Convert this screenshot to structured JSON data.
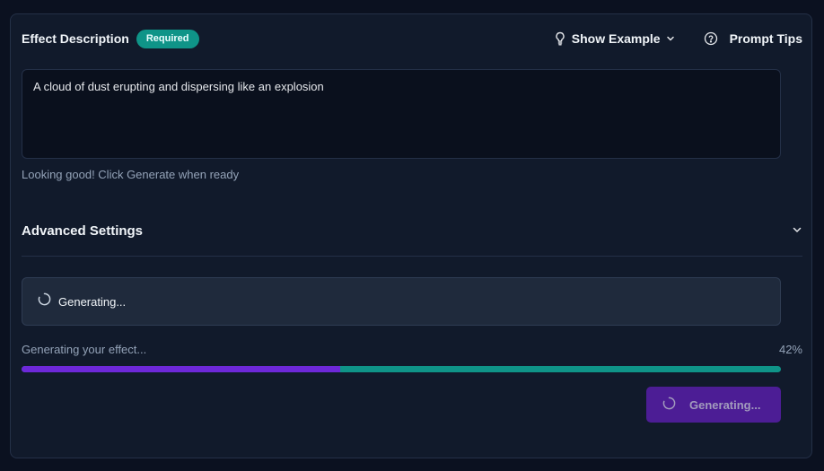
{
  "form": {
    "title": "Effect Description",
    "required_badge": "Required",
    "show_example_label": "Show Example",
    "prompt_tips_label": "Prompt Tips",
    "description_value": "A cloud of dust erupting and dispersing like an explosion",
    "hint": "Looking good! Click Generate when ready"
  },
  "advanced": {
    "title": "Advanced Settings",
    "expanded": false
  },
  "status": {
    "message": "Generating..."
  },
  "progress": {
    "label": "Generating your effect...",
    "percent_text": "42%",
    "value": 0.42
  },
  "generate_button": {
    "label": "Generating..."
  },
  "colors": {
    "accent_purple": "#6d28d9",
    "accent_teal": "#0f9488",
    "panel_bg": "#111a2b",
    "page_bg": "#0b1120"
  },
  "icons": {
    "show_example": "lightbulb-icon",
    "prompt_tips": "help-circle-icon",
    "show_example_caret": "chevron-down-icon",
    "advanced_toggle": "chevron-down-icon",
    "loading": "spinner-icon"
  }
}
